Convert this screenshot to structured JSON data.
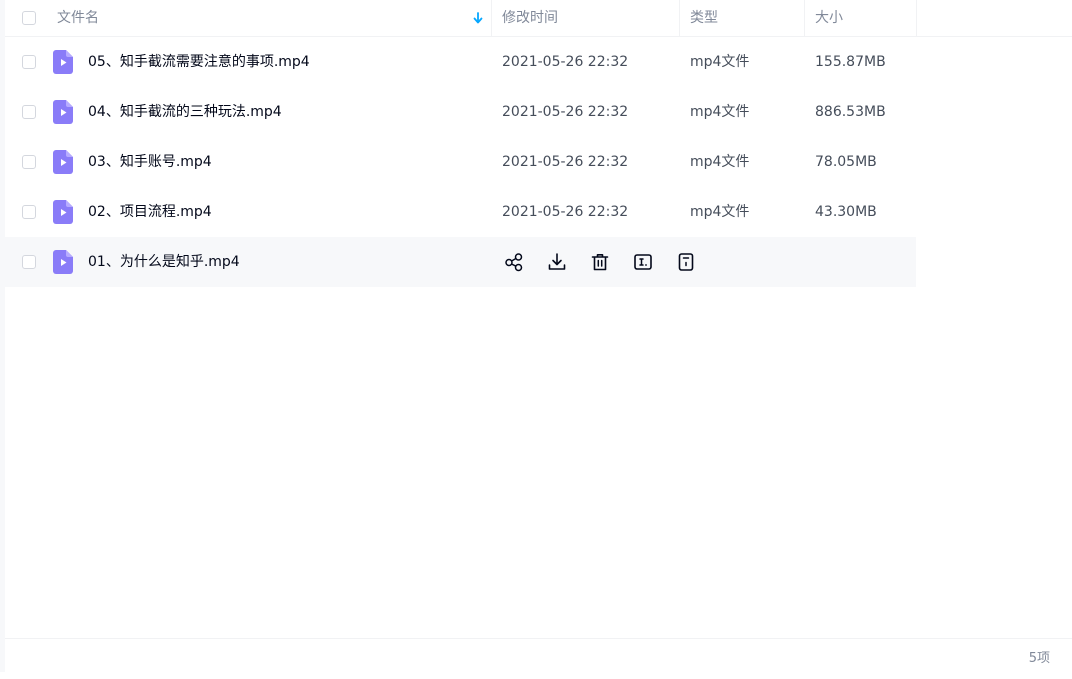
{
  "header": {
    "name_label": "文件名",
    "modified_label": "修改时间",
    "type_label": "类型",
    "size_label": "大小"
  },
  "files": [
    {
      "name": "05、知手截流需要注意的事项.mp4",
      "modified": "2021-05-26 22:32",
      "type": "mp4文件",
      "size": "155.87MB"
    },
    {
      "name": "04、知手截流的三种玩法.mp4",
      "modified": "2021-05-26 22:32",
      "type": "mp4文件",
      "size": "886.53MB"
    },
    {
      "name": "03、知手账号.mp4",
      "modified": "2021-05-26 22:32",
      "type": "mp4文件",
      "size": "78.05MB"
    },
    {
      "name": "02、项目流程.mp4",
      "modified": "2021-05-26 22:32",
      "type": "mp4文件",
      "size": "43.30MB"
    },
    {
      "name": "01、为什么是知乎.mp4"
    }
  ],
  "hover_actions": [
    "share-icon",
    "download-icon",
    "delete-icon",
    "rename-icon",
    "file-info-icon"
  ],
  "footer": {
    "count": "5项"
  },
  "colors": {
    "accent": "#06a7ff",
    "file_icon": "#8a7cf8",
    "hover_row": "#f7f8fa"
  }
}
